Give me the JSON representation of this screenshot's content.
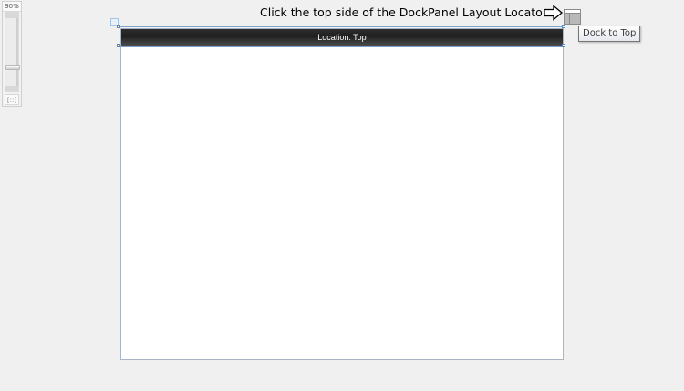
{
  "zoom": {
    "value_label": "90%",
    "level_fraction": 0.75,
    "fit_label": "[::]"
  },
  "instruction": {
    "text": "Click the top side of the DockPanel Layout Locator"
  },
  "dock_panel": {
    "header_label": "Location: Top"
  },
  "dock_locator": {
    "tooltip": "Dock to Top"
  },
  "icons": {
    "arrow": "right-arrow-icon",
    "locator": "dock-layout-locator-icon",
    "anchor": "artboard-anchor-icon"
  },
  "colors": {
    "background": "#f0f0f0",
    "artboard": "#ffffff",
    "header": "#1e1e1e",
    "selection": "#7fa3cc"
  }
}
